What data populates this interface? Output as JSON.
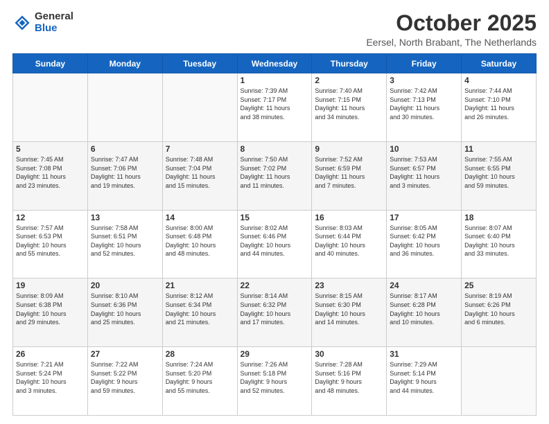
{
  "header": {
    "logo_general": "General",
    "logo_blue": "Blue",
    "month_title": "October 2025",
    "location": "Eersel, North Brabant, The Netherlands"
  },
  "days_of_week": [
    "Sunday",
    "Monday",
    "Tuesday",
    "Wednesday",
    "Thursday",
    "Friday",
    "Saturday"
  ],
  "weeks": [
    [
      {
        "day": "",
        "info": ""
      },
      {
        "day": "",
        "info": ""
      },
      {
        "day": "",
        "info": ""
      },
      {
        "day": "1",
        "info": "Sunrise: 7:39 AM\nSunset: 7:17 PM\nDaylight: 11 hours\nand 38 minutes."
      },
      {
        "day": "2",
        "info": "Sunrise: 7:40 AM\nSunset: 7:15 PM\nDaylight: 11 hours\nand 34 minutes."
      },
      {
        "day": "3",
        "info": "Sunrise: 7:42 AM\nSunset: 7:13 PM\nDaylight: 11 hours\nand 30 minutes."
      },
      {
        "day": "4",
        "info": "Sunrise: 7:44 AM\nSunset: 7:10 PM\nDaylight: 11 hours\nand 26 minutes."
      }
    ],
    [
      {
        "day": "5",
        "info": "Sunrise: 7:45 AM\nSunset: 7:08 PM\nDaylight: 11 hours\nand 23 minutes."
      },
      {
        "day": "6",
        "info": "Sunrise: 7:47 AM\nSunset: 7:06 PM\nDaylight: 11 hours\nand 19 minutes."
      },
      {
        "day": "7",
        "info": "Sunrise: 7:48 AM\nSunset: 7:04 PM\nDaylight: 11 hours\nand 15 minutes."
      },
      {
        "day": "8",
        "info": "Sunrise: 7:50 AM\nSunset: 7:02 PM\nDaylight: 11 hours\nand 11 minutes."
      },
      {
        "day": "9",
        "info": "Sunrise: 7:52 AM\nSunset: 6:59 PM\nDaylight: 11 hours\nand 7 minutes."
      },
      {
        "day": "10",
        "info": "Sunrise: 7:53 AM\nSunset: 6:57 PM\nDaylight: 11 hours\nand 3 minutes."
      },
      {
        "day": "11",
        "info": "Sunrise: 7:55 AM\nSunset: 6:55 PM\nDaylight: 10 hours\nand 59 minutes."
      }
    ],
    [
      {
        "day": "12",
        "info": "Sunrise: 7:57 AM\nSunset: 6:53 PM\nDaylight: 10 hours\nand 55 minutes."
      },
      {
        "day": "13",
        "info": "Sunrise: 7:58 AM\nSunset: 6:51 PM\nDaylight: 10 hours\nand 52 minutes."
      },
      {
        "day": "14",
        "info": "Sunrise: 8:00 AM\nSunset: 6:48 PM\nDaylight: 10 hours\nand 48 minutes."
      },
      {
        "day": "15",
        "info": "Sunrise: 8:02 AM\nSunset: 6:46 PM\nDaylight: 10 hours\nand 44 minutes."
      },
      {
        "day": "16",
        "info": "Sunrise: 8:03 AM\nSunset: 6:44 PM\nDaylight: 10 hours\nand 40 minutes."
      },
      {
        "day": "17",
        "info": "Sunrise: 8:05 AM\nSunset: 6:42 PM\nDaylight: 10 hours\nand 36 minutes."
      },
      {
        "day": "18",
        "info": "Sunrise: 8:07 AM\nSunset: 6:40 PM\nDaylight: 10 hours\nand 33 minutes."
      }
    ],
    [
      {
        "day": "19",
        "info": "Sunrise: 8:09 AM\nSunset: 6:38 PM\nDaylight: 10 hours\nand 29 minutes."
      },
      {
        "day": "20",
        "info": "Sunrise: 8:10 AM\nSunset: 6:36 PM\nDaylight: 10 hours\nand 25 minutes."
      },
      {
        "day": "21",
        "info": "Sunrise: 8:12 AM\nSunset: 6:34 PM\nDaylight: 10 hours\nand 21 minutes."
      },
      {
        "day": "22",
        "info": "Sunrise: 8:14 AM\nSunset: 6:32 PM\nDaylight: 10 hours\nand 17 minutes."
      },
      {
        "day": "23",
        "info": "Sunrise: 8:15 AM\nSunset: 6:30 PM\nDaylight: 10 hours\nand 14 minutes."
      },
      {
        "day": "24",
        "info": "Sunrise: 8:17 AM\nSunset: 6:28 PM\nDaylight: 10 hours\nand 10 minutes."
      },
      {
        "day": "25",
        "info": "Sunrise: 8:19 AM\nSunset: 6:26 PM\nDaylight: 10 hours\nand 6 minutes."
      }
    ],
    [
      {
        "day": "26",
        "info": "Sunrise: 7:21 AM\nSunset: 5:24 PM\nDaylight: 10 hours\nand 3 minutes."
      },
      {
        "day": "27",
        "info": "Sunrise: 7:22 AM\nSunset: 5:22 PM\nDaylight: 9 hours\nand 59 minutes."
      },
      {
        "day": "28",
        "info": "Sunrise: 7:24 AM\nSunset: 5:20 PM\nDaylight: 9 hours\nand 55 minutes."
      },
      {
        "day": "29",
        "info": "Sunrise: 7:26 AM\nSunset: 5:18 PM\nDaylight: 9 hours\nand 52 minutes."
      },
      {
        "day": "30",
        "info": "Sunrise: 7:28 AM\nSunset: 5:16 PM\nDaylight: 9 hours\nand 48 minutes."
      },
      {
        "day": "31",
        "info": "Sunrise: 7:29 AM\nSunset: 5:14 PM\nDaylight: 9 hours\nand 44 minutes."
      },
      {
        "day": "",
        "info": ""
      }
    ]
  ]
}
